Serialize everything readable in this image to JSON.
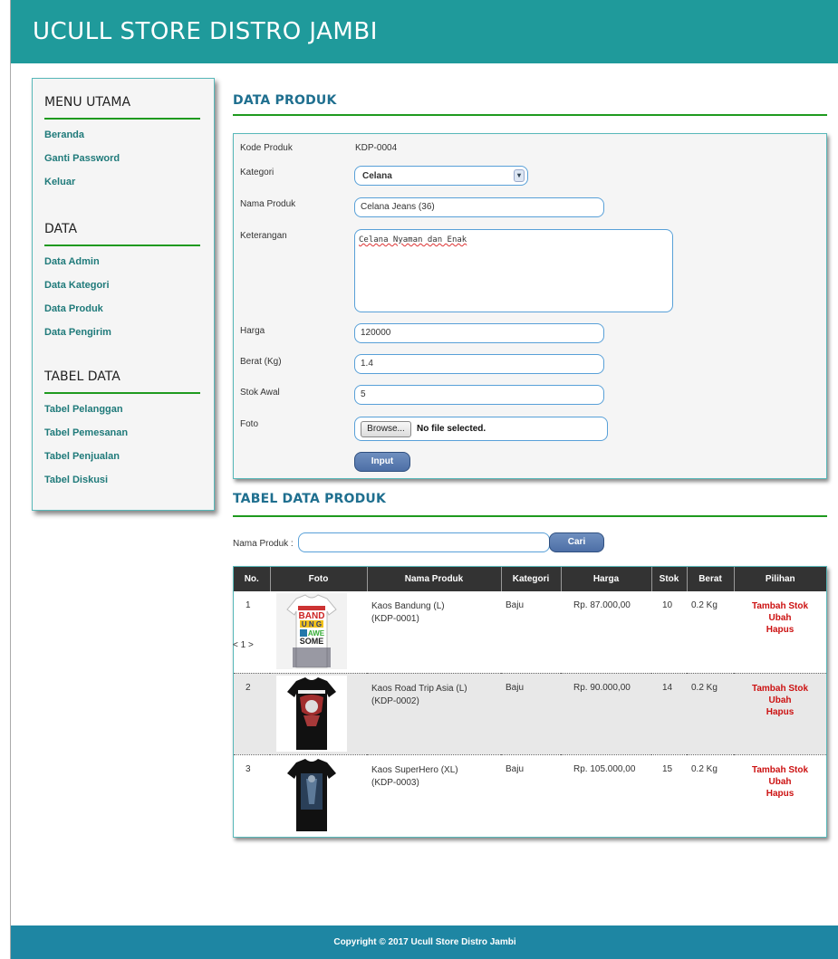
{
  "app": {
    "title": "UCULL STORE DISTRO JAMBI"
  },
  "sidebar": {
    "menu_utama": {
      "title": "MENU UTAMA",
      "items": [
        "Beranda",
        "Ganti Password",
        "Keluar"
      ]
    },
    "data": {
      "title": "DATA",
      "items": [
        "Data Admin",
        "Data Kategori",
        "Data Produk",
        "Data Pengirim"
      ]
    },
    "tabel_data": {
      "title": "TABEL DATA",
      "items": [
        "Tabel Pelanggan",
        "Tabel Pemesanan",
        "Tabel Penjualan",
        "Tabel Diskusi"
      ]
    }
  },
  "form": {
    "section_title": "DATA PRODUK",
    "kode_label": "Kode Produk",
    "kode_value": "KDP-0004",
    "kategori_label": "Kategori",
    "kategori_value": "Celana",
    "nama_label": "Nama Produk",
    "nama_value": "Celana Jeans (36)",
    "keterangan_label": "Keterangan",
    "keterangan_value": "Celana Nyaman dan Enak",
    "harga_label": "Harga",
    "harga_value": "120000",
    "berat_label": "Berat (Kg)",
    "berat_value": "1.4",
    "stok_label": "Stok Awal",
    "stok_value": "5",
    "foto_label": "Foto",
    "browse_label": "Browse...",
    "file_status": "No file selected.",
    "submit_label": "Input"
  },
  "table_section": {
    "title": "TABEL DATA PRODUK",
    "search_label": "Nama Produk :",
    "search_value": "",
    "search_button": "Cari",
    "headers": [
      "No.",
      "Foto",
      "Nama Produk",
      "Kategori",
      "Harga",
      "Stok",
      "Berat",
      "Pilihan"
    ],
    "rows": [
      {
        "no": "1",
        "nama": "Kaos Bandung (L)",
        "kode": "(KDP-0001)",
        "kategori": "Baju",
        "harga": "Rp. 87.000,00",
        "stok": "10",
        "berat": "0.2 Kg",
        "shirt_color": "#ffffff",
        "shirt_print": "BAND UNG AWE SOME"
      },
      {
        "no": "2",
        "nama": "Kaos Road Trip Asia (L)",
        "kode": "(KDP-0002)",
        "kategori": "Baju",
        "harga": "Rp. 90.000,00",
        "stok": "14",
        "berat": "0.2 Kg",
        "shirt_color": "#111111",
        "shirt_print": ""
      },
      {
        "no": "3",
        "nama": "Kaos SuperHero (XL)",
        "kode": "(KDP-0003)",
        "kategori": "Baju",
        "harga": "Rp. 105.000,00",
        "stok": "15",
        "berat": "0.2 Kg",
        "shirt_color": "#111111",
        "shirt_print": ""
      }
    ],
    "actions": [
      "Tambah Stok",
      "Ubah",
      "Hapus"
    ],
    "pager": "< 1 >"
  },
  "footer": {
    "text": "Copyright © 2017 Ucull Store Distro Jambi"
  },
  "colors": {
    "header": "#1f9a9b",
    "accent_line": "#1f9a1f",
    "footer": "#1e86a3",
    "action": "#cc1111"
  }
}
